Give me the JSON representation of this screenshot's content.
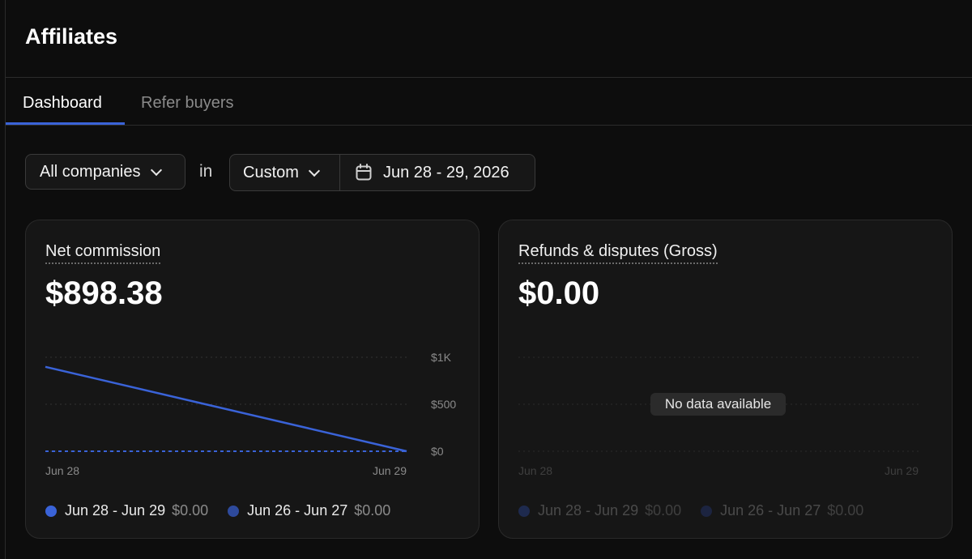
{
  "page": {
    "title": "Affiliates"
  },
  "tabs": [
    {
      "label": "Dashboard",
      "active": true
    },
    {
      "label": "Refer buyers",
      "active": false
    }
  ],
  "filters": {
    "company": "All companies",
    "in_word": "in",
    "range_preset": "Custom",
    "date_range": "Jun 28 - 29, 2026"
  },
  "colors": {
    "accent": "#3a63d8",
    "prev_series": "#2e4a9c"
  },
  "cards": [
    {
      "title": "Net commission",
      "value": "$898.38",
      "legend": [
        {
          "label": "Jun 28 - Jun 29",
          "value": "$0.00"
        },
        {
          "label": "Jun 26 - Jun 27",
          "value": "$0.00"
        }
      ]
    },
    {
      "title": "Refunds & disputes (Gross)",
      "value": "$0.00",
      "no_data": "No data available",
      "x_labels": [
        "Jun 28",
        "Jun 29"
      ],
      "legend": [
        {
          "label": "Jun 28 - Jun 29",
          "value": "$0.00"
        },
        {
          "label": "Jun 26 - Jun 27",
          "value": "$0.00"
        }
      ]
    }
  ],
  "chart_data": {
    "type": "line",
    "categories": [
      "Jun 28",
      "Jun 29"
    ],
    "y_ticks": [
      "$1K",
      "$500",
      "$0"
    ],
    "ylim": [
      0,
      1000
    ],
    "grid": true,
    "legend_position": "bottom-left",
    "series": [
      {
        "name": "Jun 28 - Jun 29",
        "values": [
          898.38,
          0
        ],
        "style": "solid"
      },
      {
        "name": "Jun 26 - Jun 27",
        "values": [
          0,
          0
        ],
        "style": "dashed"
      }
    ]
  }
}
